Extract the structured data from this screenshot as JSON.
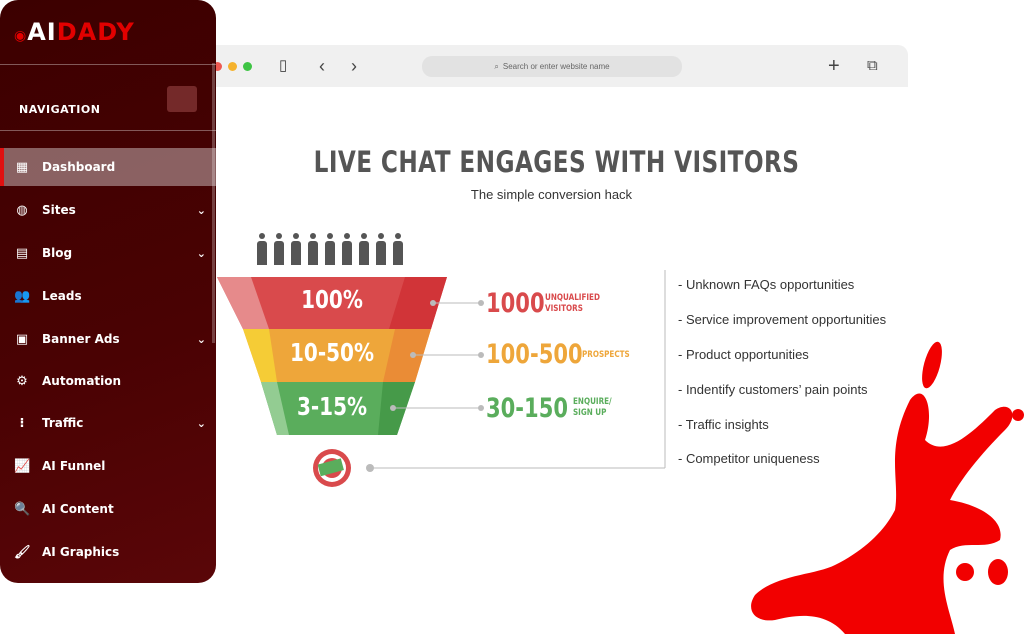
{
  "brand": {
    "logo_part1": "AI",
    "logo_part2": "DADY"
  },
  "sidebar": {
    "heading": "NAVIGATION",
    "items": [
      {
        "label": "Dashboard",
        "icon": "dashboard-icon",
        "active": true
      },
      {
        "label": "Sites",
        "icon": "globe-icon",
        "chevron": true
      },
      {
        "label": "Blog",
        "icon": "newspaper-icon",
        "chevron": true
      },
      {
        "label": "Leads",
        "icon": "users-icon"
      },
      {
        "label": "Banner Ads",
        "icon": "image-icon",
        "chevron": true
      },
      {
        "label": "Automation",
        "icon": "gear-icon"
      },
      {
        "label": "Traffic",
        "icon": "traffic-light-icon",
        "chevron": true
      },
      {
        "label": "AI Funnel",
        "icon": "chart-line-icon"
      },
      {
        "label": "AI Content",
        "icon": "search-icon"
      },
      {
        "label": "AI Graphics",
        "icon": "brush-icon"
      }
    ]
  },
  "browser": {
    "address_placeholder": "Search or enter website name"
  },
  "infographic": {
    "title": "LIVE CHAT ENGAGES WITH VISITORS",
    "subtitle": "The simple conversion hack",
    "stages": [
      {
        "percent": "100%",
        "count": "1000",
        "label_line1": "UNQUALIFIED",
        "label_line2": "VISITORS",
        "color": "#d94a4c"
      },
      {
        "percent": "10-50%",
        "count": "100-500",
        "label_line1": "PROSPECTS",
        "label_line2": "",
        "color": "#eea63a"
      },
      {
        "percent": "3-15%",
        "count": "30-150",
        "label_line1": "ENQUIRE/",
        "label_line2": "SIGN UP",
        "color": "#5aad5c"
      }
    ],
    "benefits": [
      "- Unknown FAQs opportunities",
      "- Service improvement opportunities",
      "- Product opportunities",
      "- Indentify customers’ pain points",
      "- Traffic insights",
      "- Competitor uniqueness"
    ]
  }
}
